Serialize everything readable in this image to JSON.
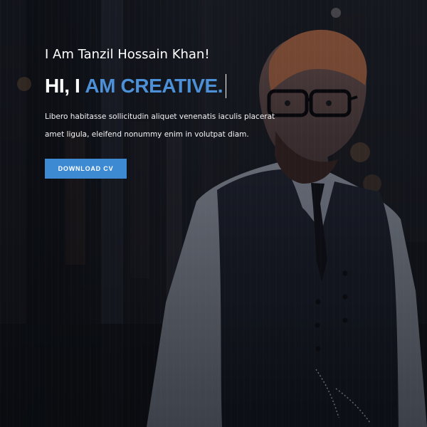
{
  "hero": {
    "intro": "I Am Tanzil Hossain Khan!",
    "headline_prefix": "HI, I",
    "headline_highlight": "AM CREATIVE.",
    "description": "Libero habitasse sollicitudin aliquet venenatis iaculis placerat amet ligula, eleifend nonummy enim in volutpat diam.",
    "button_label": "DOWNLOAD CV"
  },
  "colors": {
    "accent": "#4c90d8",
    "button": "#3d8ad3",
    "text": "#ffffff",
    "background": "#14151b"
  }
}
